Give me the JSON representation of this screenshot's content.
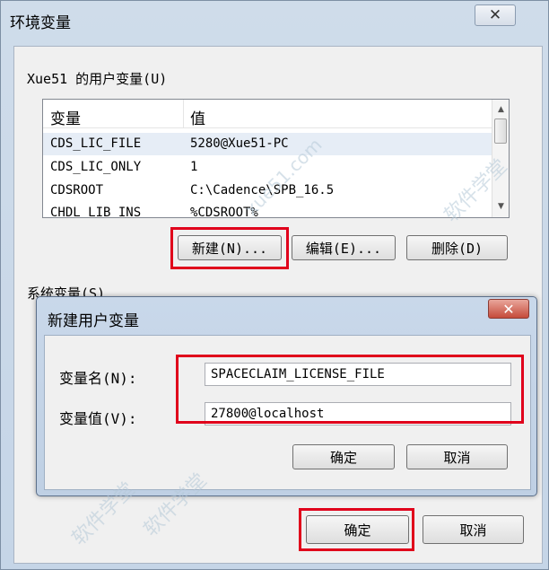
{
  "window": {
    "title": "环境变量",
    "close_glyph": "✕"
  },
  "user_vars": {
    "group_label": "Xue51 的用户变量(U)",
    "columns": [
      "变量",
      "值"
    ],
    "rows": [
      {
        "name": "CDS_LIC_FILE",
        "value": "5280@Xue51-PC"
      },
      {
        "name": "CDS_LIC_ONLY",
        "value": "1"
      },
      {
        "name": "CDSROOT",
        "value": "C:\\Cadence\\SPB_16.5"
      },
      {
        "name": "CHDL_LIB_INS",
        "value": "%CDSROOT%"
      }
    ],
    "buttons": {
      "new": "新建(N)...",
      "edit": "编辑(E)...",
      "delete": "删除(D)"
    }
  },
  "system_vars": {
    "group_label": "系统变量(S)"
  },
  "dialog": {
    "title": "新建用户变量",
    "close_glyph": "✕",
    "name_label": "变量名(N):",
    "name_value": "SPACECLAIM_LICENSE_FILE",
    "value_label": "变量值(V):",
    "value_value": "27800@localhost",
    "ok": "确定",
    "cancel": "取消"
  },
  "footer": {
    "ok": "确定",
    "cancel": "取消"
  },
  "watermark": {
    "text1": "软件学堂",
    "text2": "xue51.com"
  },
  "colors": {
    "highlight_box": "#e0001b",
    "title_bar": "#c9d8ea",
    "dialog_close": "#c54b3b"
  }
}
